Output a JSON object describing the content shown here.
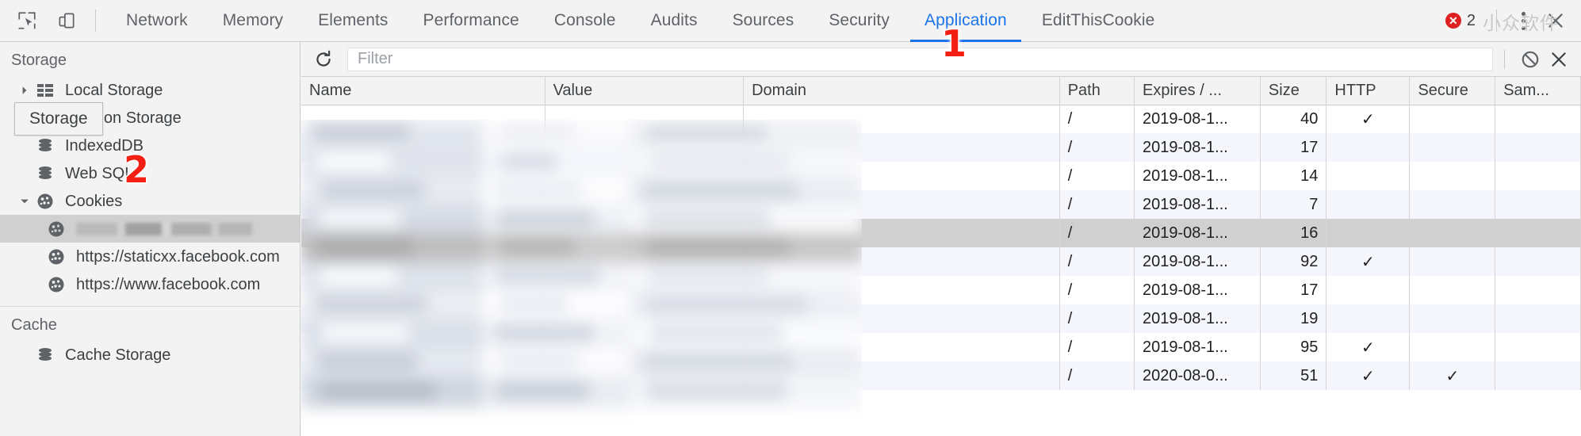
{
  "toolbar": {
    "inspect_icon": "inspect-cursor-icon",
    "device_icon": "device-toggle-icon",
    "tabs": [
      {
        "label": "Network",
        "active": false
      },
      {
        "label": "Memory",
        "active": false
      },
      {
        "label": "Elements",
        "active": false
      },
      {
        "label": "Performance",
        "active": false
      },
      {
        "label": "Console",
        "active": false
      },
      {
        "label": "Audits",
        "active": false
      },
      {
        "label": "Sources",
        "active": false
      },
      {
        "label": "Security",
        "active": false
      },
      {
        "label": "Application",
        "active": true
      },
      {
        "label": "EditThisCookie",
        "active": false
      }
    ],
    "error_count": "2",
    "error_icon": "error-circle-icon",
    "menu_icon": "kebab-menu-icon",
    "close_icon": "close-icon",
    "watermark": "小众软件",
    "accent_color": "#1a73e8",
    "error_color": "#df2020"
  },
  "sidebar": {
    "sections": [
      {
        "title": "Storage",
        "items": [
          {
            "label": "Local Storage",
            "icon": "table-icon",
            "indent": 1,
            "twisty": "right",
            "selected": false
          },
          {
            "label": "Session Storage",
            "icon": "table-icon",
            "indent": 1,
            "twisty": "right",
            "selected": false
          },
          {
            "label": "IndexedDB",
            "icon": "database-icon",
            "indent": 1,
            "twisty": "none",
            "selected": false
          },
          {
            "label": "Web SQL",
            "icon": "database-icon",
            "indent": 1,
            "twisty": "none",
            "selected": false
          },
          {
            "label": "Cookies",
            "icon": "cookie-icon",
            "indent": 1,
            "twisty": "down",
            "selected": false
          },
          {
            "label": "",
            "icon": "cookie-icon",
            "indent": 2,
            "twisty": "none",
            "selected": true,
            "redacted": true
          },
          {
            "label": "https://staticxx.facebook.com",
            "icon": "cookie-icon",
            "indent": 2,
            "twisty": "none",
            "selected": false
          },
          {
            "label": "https://www.facebook.com",
            "icon": "cookie-icon",
            "indent": 2,
            "twisty": "none",
            "selected": false
          }
        ]
      },
      {
        "title": "Cache",
        "items": [
          {
            "label": "Cache Storage",
            "icon": "database-icon",
            "indent": 1,
            "twisty": "none",
            "selected": false
          }
        ]
      }
    ],
    "tooltip": "Storage"
  },
  "filterbar": {
    "refresh_icon": "refresh-icon",
    "filter_placeholder": "Filter",
    "filter_value": "",
    "clear_all_icon": "block-circle-icon",
    "delete_icon": "close-x-icon"
  },
  "table": {
    "columns": [
      "Name",
      "Value",
      "Domain",
      "Path",
      "Expires / ...",
      "Size",
      "HTTP",
      "Secure",
      "Sam..."
    ],
    "rows": [
      {
        "name": "",
        "value": "",
        "domain": "",
        "path": "/",
        "expires": "2019-08-1...",
        "size": "40",
        "http": "✓",
        "secure": "",
        "samesite": "",
        "selected": false
      },
      {
        "name": "",
        "value": "",
        "domain": "",
        "path": "/",
        "expires": "2019-08-1...",
        "size": "17",
        "http": "",
        "secure": "",
        "samesite": "",
        "selected": false
      },
      {
        "name": "",
        "value": "",
        "domain": "",
        "path": "/",
        "expires": "2019-08-1...",
        "size": "14",
        "http": "",
        "secure": "",
        "samesite": "",
        "selected": false
      },
      {
        "name": "",
        "value": "",
        "domain": "",
        "path": "/",
        "expires": "2019-08-1...",
        "size": "7",
        "http": "",
        "secure": "",
        "samesite": "",
        "selected": false
      },
      {
        "name": "",
        "value": "",
        "domain": "",
        "path": "/",
        "expires": "2019-08-1...",
        "size": "16",
        "http": "",
        "secure": "",
        "samesite": "",
        "selected": true
      },
      {
        "name": "",
        "value": "",
        "domain": "",
        "path": "/",
        "expires": "2019-08-1...",
        "size": "92",
        "http": "✓",
        "secure": "",
        "samesite": "",
        "selected": false
      },
      {
        "name": "",
        "value": "",
        "domain": "",
        "path": "/",
        "expires": "2019-08-1...",
        "size": "17",
        "http": "",
        "secure": "",
        "samesite": "",
        "selected": false
      },
      {
        "name": "",
        "value": "",
        "domain": "",
        "path": "/",
        "expires": "2019-08-1...",
        "size": "19",
        "http": "",
        "secure": "",
        "samesite": "",
        "selected": false
      },
      {
        "name": "",
        "value": "",
        "domain": "",
        "path": "/",
        "expires": "2019-08-1...",
        "size": "95",
        "http": "✓",
        "secure": "",
        "samesite": "",
        "selected": false
      },
      {
        "name": "",
        "value": "",
        "domain": "",
        "path": "/",
        "expires": "2020-08-0...",
        "size": "51",
        "http": "✓",
        "secure": "✓",
        "samesite": "",
        "selected": false
      }
    ],
    "redacted_note": "Name, Value and Domain cell contents are blurred out"
  },
  "annotations": [
    {
      "id": "1",
      "label": "1"
    },
    {
      "id": "2",
      "label": "2"
    }
  ]
}
